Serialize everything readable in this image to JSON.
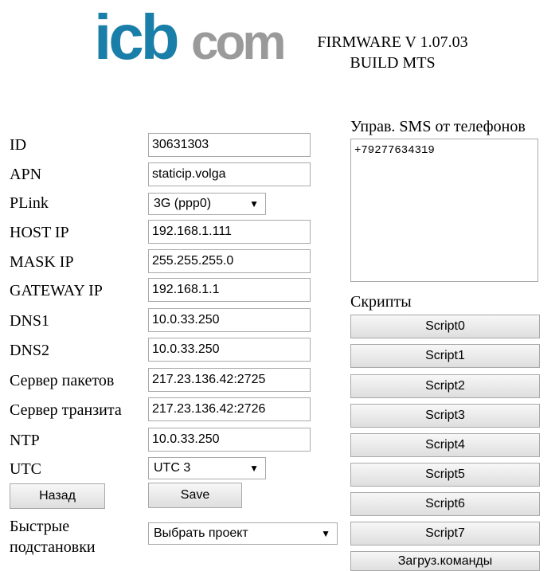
{
  "header": {
    "logo_text": "icbcom",
    "firmware_line1": "FIRMWARE V 1.07.03",
    "firmware_line2": "BUILD MTS",
    "logo_colors": {
      "icb": "#1a7fa8",
      "com": "#9a9a9a"
    }
  },
  "form": {
    "fields": [
      {
        "label": "ID",
        "value": "30631303"
      },
      {
        "label": "APN",
        "value": "staticip.volga"
      },
      {
        "label": "PLink",
        "value": "3G (ppp0)"
      },
      {
        "label": "HOST IP",
        "value": "192.168.1.111"
      },
      {
        "label": "MASK IP",
        "value": "255.255.255.0"
      },
      {
        "label": "GATEWAY IP",
        "value": "192.168.1.1"
      },
      {
        "label": "DNS1",
        "value": "10.0.33.250"
      },
      {
        "label": "DNS2",
        "value": "10.0.33.250"
      },
      {
        "label": "Сервер пакетов",
        "value": "217.23.136.42:2725"
      },
      {
        "label": "Сервер транзита",
        "value": "217.23.136.42:2726"
      },
      {
        "label": "NTP",
        "value": "10.0.33.250"
      },
      {
        "label": "UTC",
        "value": "UTC 3"
      }
    ],
    "back_label": "Назад",
    "save_label": "Save",
    "quick_label_line1": "Быстрые",
    "quick_label_line2": "подстановки",
    "quick_select_value": "Выбрать проект"
  },
  "sms": {
    "title": "Управ. SMS от телефонов",
    "phone": "+79277634319"
  },
  "scripts": {
    "title": "Скрипты",
    "buttons": [
      "Script0",
      "Script1",
      "Script2",
      "Script3",
      "Script4",
      "Script5",
      "Script6",
      "Script7"
    ],
    "load_label": "Загруз.команды"
  }
}
